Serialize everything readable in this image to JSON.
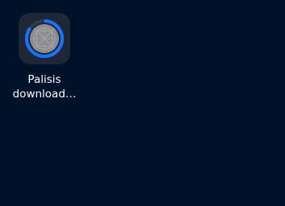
{
  "desktop": {
    "background": "#00112a",
    "apps": [
      {
        "name_line": "Palisis",
        "status_line": "download…",
        "icon": "placeholder-app-icon",
        "download_progress": 0.85,
        "progress_color": "#1a73ff"
      }
    ]
  }
}
